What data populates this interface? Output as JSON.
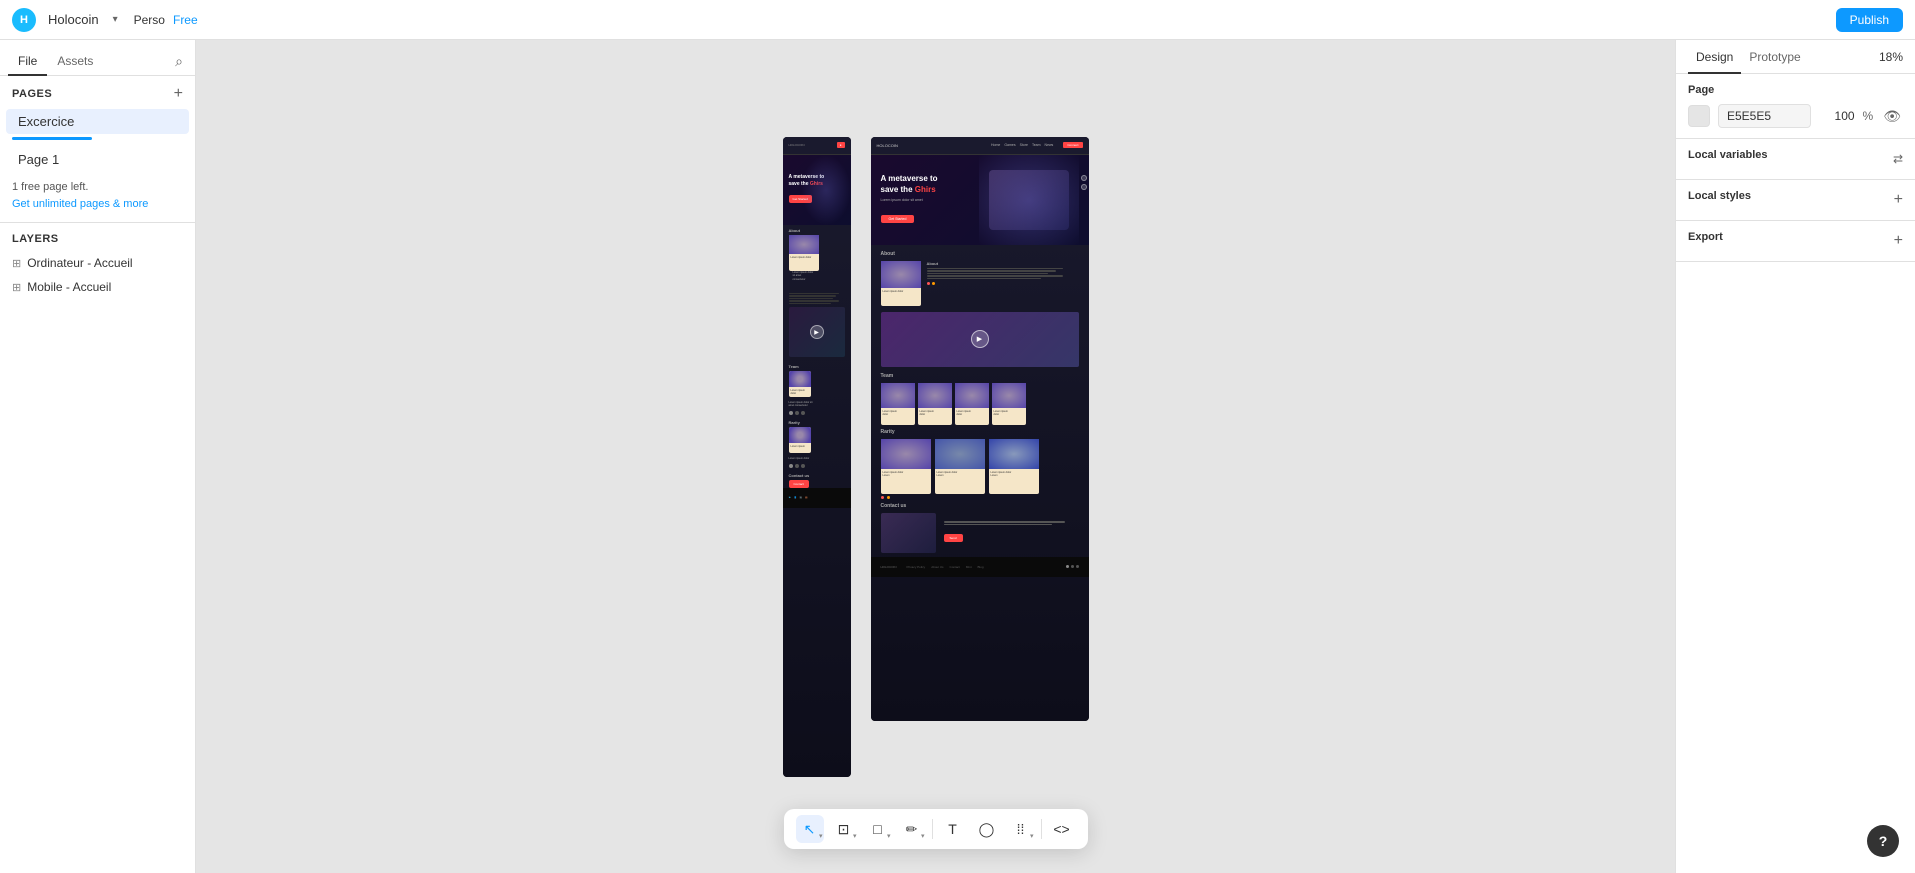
{
  "topbar": {
    "app_name": "Holocoin",
    "chevron": "▾",
    "link_perso": "Perso",
    "link_free": "Free",
    "publish_label": "Publish"
  },
  "sidebar": {
    "file_tab": "File",
    "assets_tab": "Assets",
    "search_icon": "🔍",
    "pages_section": "Pages",
    "add_page_icon": "+",
    "pages": [
      {
        "name": "Excercice",
        "active": true
      },
      {
        "name": "Page 1",
        "active": false
      }
    ],
    "upgrade_notice": "1 free page left.",
    "upgrade_link": "Get unlimited pages & more",
    "layers_section": "Layers",
    "layers": [
      {
        "name": "Ordinateur - Accueil",
        "icon": "⊞"
      },
      {
        "name": "Mobile - Accueil",
        "icon": "⊞"
      }
    ]
  },
  "right_panel": {
    "design_tab": "Design",
    "prototype_tab": "Prototype",
    "zoom_value": "18%",
    "page_section": "Page",
    "color_value": "E5E5E5",
    "opacity_value": "100",
    "opacity_unit": "%",
    "local_variables": "Local variables",
    "local_styles": "Local styles",
    "export": "Export"
  },
  "toolbar": {
    "select_tool": "↖",
    "frame_tool": "⊡",
    "rect_tool": "□",
    "pen_tool": "✏",
    "text_tool": "T",
    "comment_tool": "💬",
    "component_tool": "⋮⋮",
    "code_tool": "<>"
  },
  "canvas": {
    "mobile_label": "",
    "desktop_label": ""
  },
  "help": "?"
}
